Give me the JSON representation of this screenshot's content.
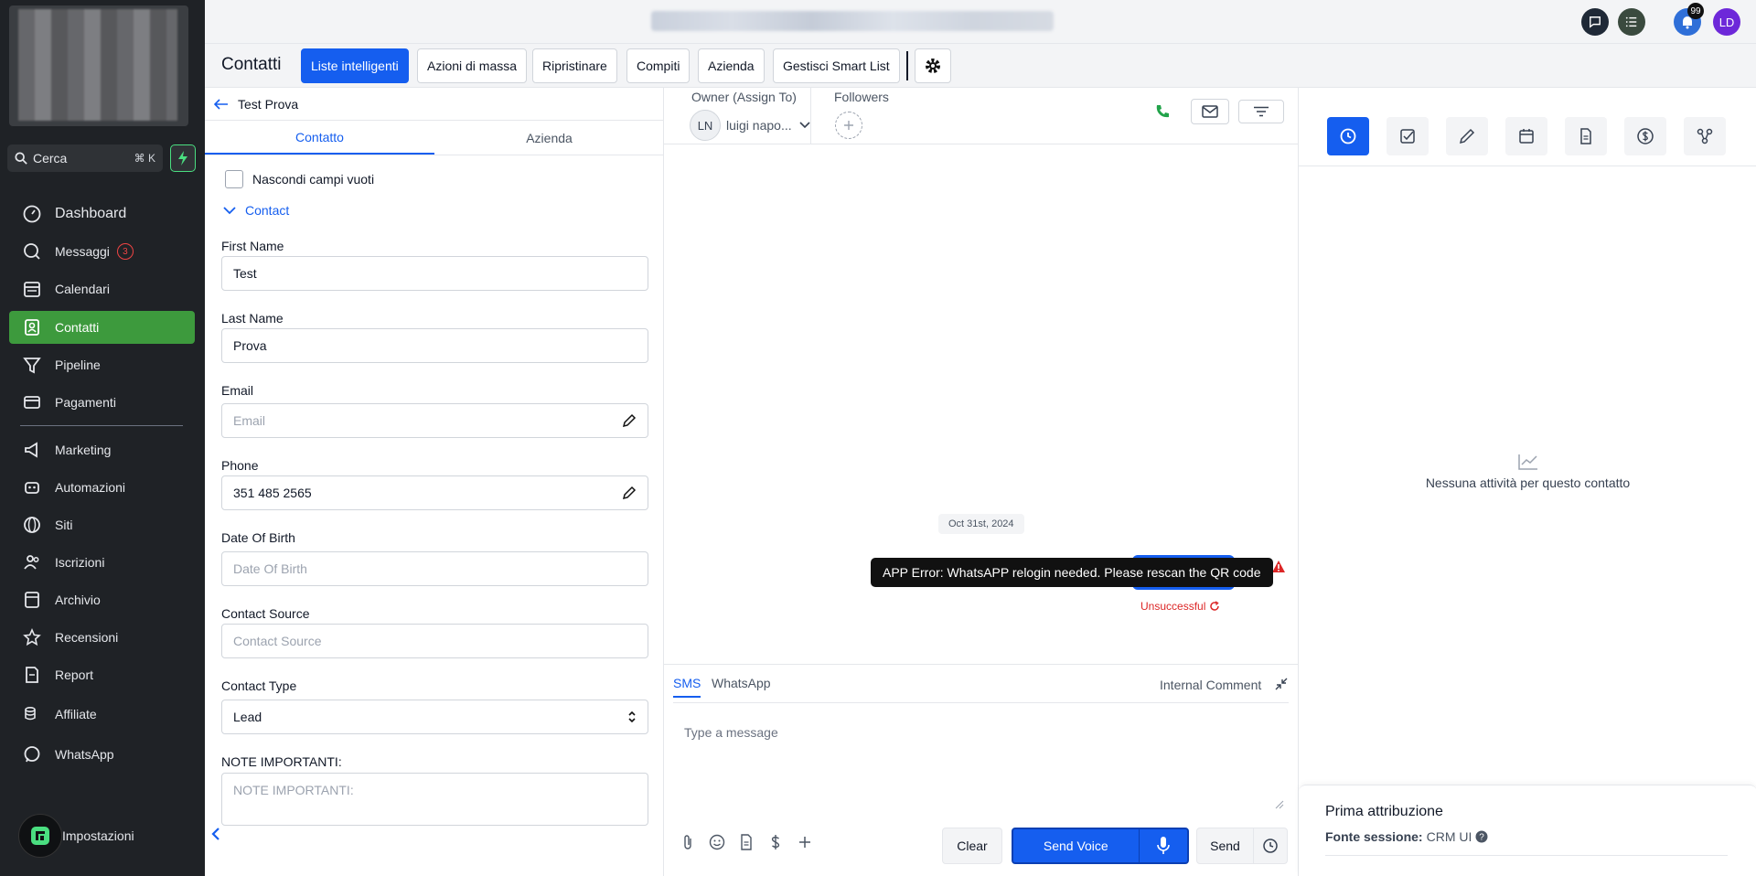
{
  "sidebar": {
    "search_label": "Cerca",
    "search_shortcut": "⌘ K",
    "items": [
      {
        "label": "Dashboard",
        "icon": "dashboard-icon"
      },
      {
        "label": "Messaggi",
        "icon": "chat-icon",
        "badge": "3"
      },
      {
        "label": "Calendari",
        "icon": "calendar-icon"
      },
      {
        "label": "Contatti",
        "icon": "contacts-icon",
        "active": true
      },
      {
        "label": "Pipeline",
        "icon": "funnel-icon"
      },
      {
        "label": "Pagamenti",
        "icon": "payment-icon"
      },
      {
        "label": "Marketing",
        "icon": "megaphone-icon"
      },
      {
        "label": "Automazioni",
        "icon": "robot-icon"
      },
      {
        "label": "Siti",
        "icon": "globe-icon"
      },
      {
        "label": "Iscrizioni",
        "icon": "users-icon"
      },
      {
        "label": "Archivio",
        "icon": "archive-icon"
      },
      {
        "label": "Recensioni",
        "icon": "star-icon"
      },
      {
        "label": "Report",
        "icon": "report-icon"
      },
      {
        "label": "Affiliate",
        "icon": "coins-icon"
      },
      {
        "label": "WhatsApp",
        "icon": "whatsapp-icon"
      }
    ],
    "settings_label": "Impostazioni",
    "active_color": "#3d9a3d"
  },
  "topbar": {
    "notification_count": "99",
    "user_initials": "LD"
  },
  "tabbar": {
    "title": "Contatti",
    "buttons": [
      "Liste intelligenti",
      "Azioni di massa",
      "Ripristinare",
      "Compiti",
      "Azienda",
      "Gestisci Smart List"
    ]
  },
  "contact": {
    "back_name": "Test Prova",
    "tabs": [
      "Contatto",
      "Azienda"
    ],
    "hide_empty_label": "Nascondi campi vuoti",
    "section_label": "Contact",
    "fields": {
      "first_name": {
        "label": "First Name",
        "value": "Test"
      },
      "last_name": {
        "label": "Last Name",
        "value": "Prova"
      },
      "email": {
        "label": "Email",
        "placeholder": "Email"
      },
      "phone": {
        "label": "Phone",
        "value": "351 485 2565"
      },
      "dob": {
        "label": "Date Of Birth",
        "placeholder": "Date Of Birth"
      },
      "source": {
        "label": "Contact Source",
        "placeholder": "Contact Source"
      },
      "type": {
        "label": "Contact Type",
        "value": "Lead"
      },
      "notes": {
        "label": "NOTE IMPORTANTI:",
        "placeholder": "NOTE IMPORTANTI:"
      }
    }
  },
  "conversation": {
    "owner_label": "Owner (Assign To)",
    "owner_initials": "LN",
    "owner_name": "luigi napo...",
    "followers_label": "Followers",
    "date_chip": "Oct 31st, 2024",
    "error_tooltip": "APP Error: WhatsAPP relogin needed. Please rescan the QR code",
    "status_text": "Unsuccessful",
    "composer": {
      "tabs": [
        "SMS",
        "WhatsApp"
      ],
      "internal_comment": "Internal Comment",
      "placeholder": "Type a message",
      "clear_label": "Clear",
      "send_voice_label": "Send Voice",
      "send_label": "Send"
    },
    "accent": "#155eef"
  },
  "activity": {
    "empty_text": "Nessuna attività per questo contatto",
    "attribution_title": "Prima attribuzione",
    "session_source_label": "Fonte sessione:",
    "session_source_value": "CRM UI"
  }
}
